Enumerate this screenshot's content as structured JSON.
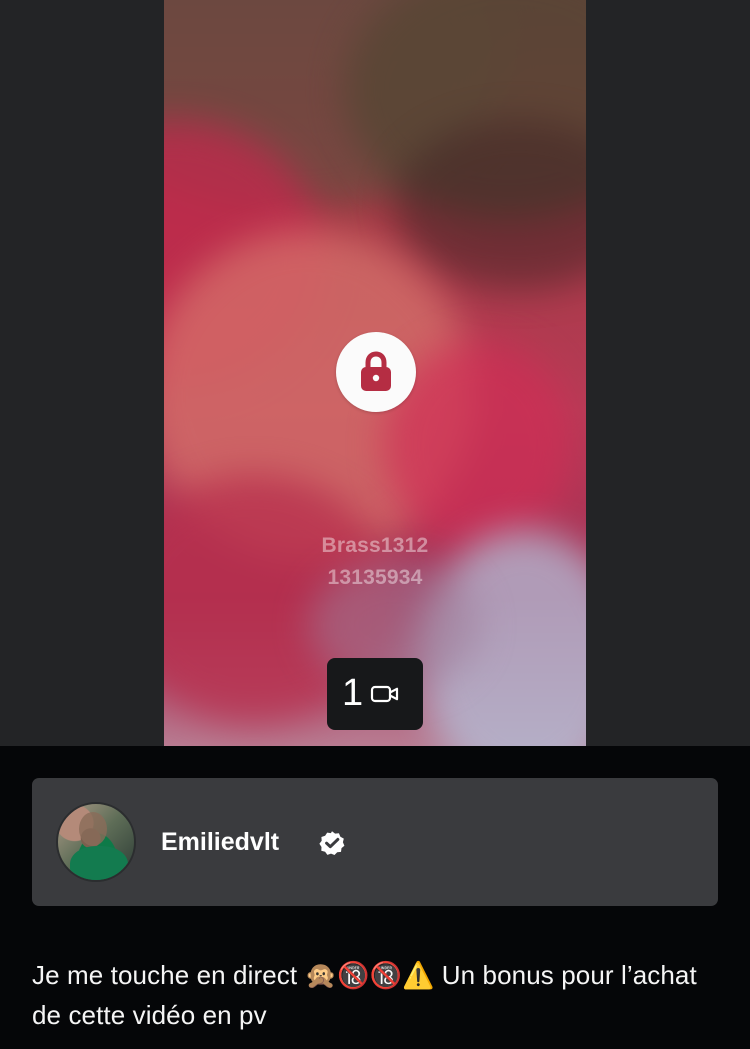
{
  "preview": {
    "locked_icon": "lock-icon",
    "watermark": {
      "username": "Brass1312",
      "id": "13135934"
    },
    "media_count": {
      "count": "1",
      "icon": "video-camera-icon"
    }
  },
  "creator": {
    "name": "Emiliedvlt",
    "avatar_icon": "avatar",
    "verified_icon": "verified-check-icon"
  },
  "post": {
    "text": "Je me touche en direct 🙊🔞🔞⚠️ Un bonus pour l’achat de cette vidéo en pv"
  },
  "colors": {
    "screen_background": "#050608",
    "media_background": "#232426",
    "card_background": "#3a3b3e",
    "lock_circle": "#fbfbfb",
    "lock_accent": "#b52d43",
    "text": "#ffffff"
  }
}
